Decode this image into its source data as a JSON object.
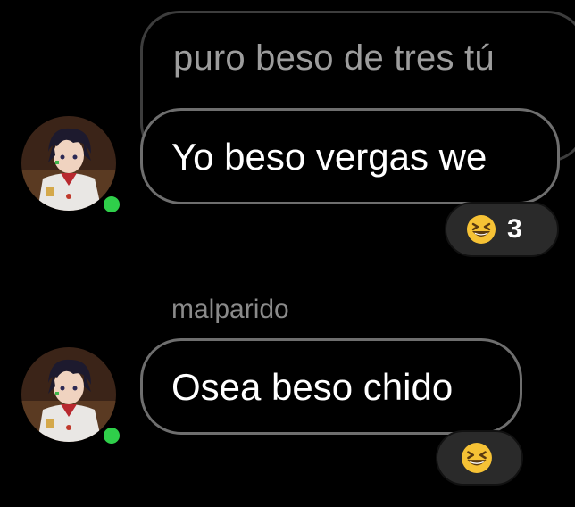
{
  "chat": {
    "quoted_reply": {
      "text": "puro beso de tres tú"
    },
    "messages": [
      {
        "text": "Yo beso vergas we",
        "reaction": {
          "emoji_icon": "grinning-squinting-face-icon",
          "count": "3"
        }
      },
      {
        "sender": "malparido",
        "text": "Osea beso chido",
        "reaction": {
          "emoji_icon": "grinning-squinting-face-icon"
        }
      }
    ]
  },
  "colors": {
    "background": "#000000",
    "bubble_border": "#6e6e6e",
    "reaction_bg": "#2a2a2a",
    "online": "#2fcf4a",
    "emoji_yellow": "#f6c235"
  }
}
